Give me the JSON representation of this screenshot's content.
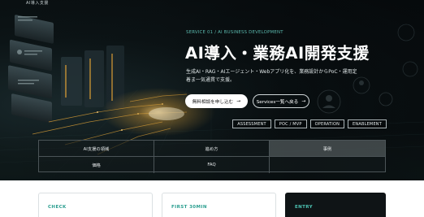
{
  "topbar": {
    "text": "AI導入支援"
  },
  "hero": {
    "eyebrow": "SERVICE 01 / AI BUSINESS DEVELOPMENT",
    "title": "AI導入・業務AI開発支援",
    "description": "生成AI・RAG・AIエージェント・Webアプリ化を、業務設計からPoC・運用定着ま一気通貫で支援。",
    "primary_button": "無料相談を申し込む",
    "secondary_button": "Services一覧へ戻る",
    "button_arrow": "→",
    "tags": [
      "ASSESSMENT",
      "POC / MVP",
      "OPERATION",
      "ENABLEMENT"
    ]
  },
  "nav": {
    "items": [
      "AI支援の領域",
      "進め方",
      "事例",
      "価格",
      "FAQ",
      ""
    ]
  },
  "cards": [
    {
      "label": "CHECK"
    },
    {
      "label": "FIRST 30MIN"
    },
    {
      "label": "ENTRY"
    }
  ],
  "colors": {
    "accent": "#2a9e8f",
    "hero_bg": "#0c1416",
    "glow": "#e8a93a"
  }
}
